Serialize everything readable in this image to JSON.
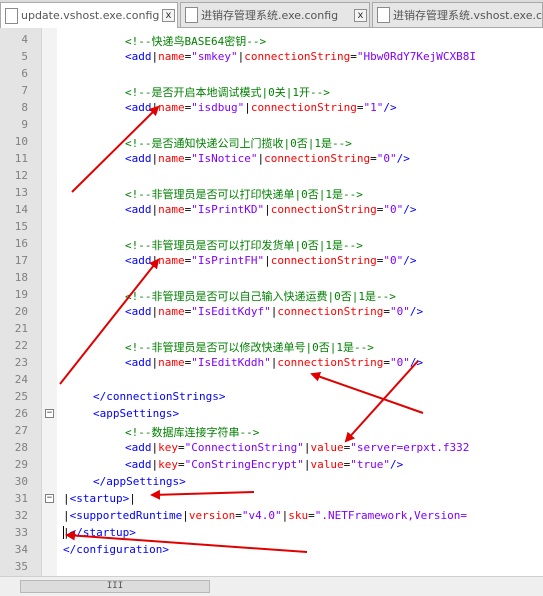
{
  "tabs": [
    {
      "label": "update.vshost.exe.config",
      "active": true
    },
    {
      "label": "进销存管理系统.exe.config",
      "active": false
    },
    {
      "label": "进销存管理系统.vshost.exe.config",
      "active": false
    }
  ],
  "close_glyph": "x",
  "scroll_grip": "III",
  "lines": [
    {
      "n": "4",
      "tokens": [
        {
          "t": "<!--快递鸟BASE64密钥-->",
          "c": "comment"
        }
      ]
    },
    {
      "n": "5",
      "tokens": [
        {
          "t": "<add",
          "c": "tag"
        },
        {
          "t": "|",
          "c": "sep"
        },
        {
          "t": "name",
          "c": "attr"
        },
        {
          "t": "=",
          "c": "sep"
        },
        {
          "t": "\"smkey\"",
          "c": "val"
        },
        {
          "t": "|",
          "c": "sep"
        },
        {
          "t": "connectionString",
          "c": "attr"
        },
        {
          "t": "=",
          "c": "sep"
        },
        {
          "t": "\"Hbw0RdY7KejWCXB8I",
          "c": "val"
        }
      ]
    },
    {
      "n": "6",
      "tokens": []
    },
    {
      "n": "7",
      "tokens": [
        {
          "t": "<!--是否开启本地调试模式|0关|1开-->",
          "c": "comment"
        }
      ]
    },
    {
      "n": "8",
      "tokens": [
        {
          "t": "<add",
          "c": "tag"
        },
        {
          "t": "|",
          "c": "sep"
        },
        {
          "t": "name",
          "c": "attr"
        },
        {
          "t": "=",
          "c": "sep"
        },
        {
          "t": "\"isdbug\"",
          "c": "val"
        },
        {
          "t": "|",
          "c": "sep"
        },
        {
          "t": "connectionString",
          "c": "attr"
        },
        {
          "t": "=",
          "c": "sep"
        },
        {
          "t": "\"1\"",
          "c": "val"
        },
        {
          "t": "/>",
          "c": "tag"
        }
      ]
    },
    {
      "n": "9",
      "tokens": []
    },
    {
      "n": "10",
      "tokens": [
        {
          "t": "<!--是否通知快递公司上门揽收|0否|1是-->",
          "c": "comment"
        }
      ]
    },
    {
      "n": "11",
      "tokens": [
        {
          "t": "<add",
          "c": "tag"
        },
        {
          "t": "|",
          "c": "sep"
        },
        {
          "t": "name",
          "c": "attr"
        },
        {
          "t": "=",
          "c": "sep"
        },
        {
          "t": "\"IsNotice\"",
          "c": "val"
        },
        {
          "t": "|",
          "c": "sep"
        },
        {
          "t": "connectionString",
          "c": "attr"
        },
        {
          "t": "=",
          "c": "sep"
        },
        {
          "t": "\"0\"",
          "c": "val"
        },
        {
          "t": "/>",
          "c": "tag"
        }
      ]
    },
    {
      "n": "12",
      "tokens": []
    },
    {
      "n": "13",
      "tokens": [
        {
          "t": "<!--非管理员是否可以打印快递单|0否|1是-->",
          "c": "comment"
        }
      ]
    },
    {
      "n": "14",
      "tokens": [
        {
          "t": "<add",
          "c": "tag"
        },
        {
          "t": "|",
          "c": "sep"
        },
        {
          "t": "name",
          "c": "attr"
        },
        {
          "t": "=",
          "c": "sep"
        },
        {
          "t": "\"IsPrintKD\"",
          "c": "val"
        },
        {
          "t": "|",
          "c": "sep"
        },
        {
          "t": "connectionString",
          "c": "attr"
        },
        {
          "t": "=",
          "c": "sep"
        },
        {
          "t": "\"0\"",
          "c": "val"
        },
        {
          "t": "/>",
          "c": "tag"
        }
      ]
    },
    {
      "n": "15",
      "tokens": []
    },
    {
      "n": "16",
      "tokens": [
        {
          "t": "<!--非管理员是否可以打印发货单|0否|1是-->",
          "c": "comment"
        }
      ]
    },
    {
      "n": "17",
      "tokens": [
        {
          "t": "<add",
          "c": "tag"
        },
        {
          "t": "|",
          "c": "sep"
        },
        {
          "t": "name",
          "c": "attr"
        },
        {
          "t": "=",
          "c": "sep"
        },
        {
          "t": "\"IsPrintFH\"",
          "c": "val"
        },
        {
          "t": "|",
          "c": "sep"
        },
        {
          "t": "connectionString",
          "c": "attr"
        },
        {
          "t": "=",
          "c": "sep"
        },
        {
          "t": "\"0\"",
          "c": "val"
        },
        {
          "t": "/>",
          "c": "tag"
        }
      ]
    },
    {
      "n": "18",
      "tokens": []
    },
    {
      "n": "19",
      "tokens": [
        {
          "t": "<!--非管理员是否可以自己输入快递运费|0否|1是-->",
          "c": "comment"
        }
      ]
    },
    {
      "n": "20",
      "tokens": [
        {
          "t": "<add",
          "c": "tag"
        },
        {
          "t": "|",
          "c": "sep"
        },
        {
          "t": "name",
          "c": "attr"
        },
        {
          "t": "=",
          "c": "sep"
        },
        {
          "t": "\"IsEditKdyf\"",
          "c": "val"
        },
        {
          "t": "|",
          "c": "sep"
        },
        {
          "t": "connectionString",
          "c": "attr"
        },
        {
          "t": "=",
          "c": "sep"
        },
        {
          "t": "\"0\"",
          "c": "val"
        },
        {
          "t": "/>",
          "c": "tag"
        }
      ]
    },
    {
      "n": "21",
      "tokens": []
    },
    {
      "n": "22",
      "tokens": [
        {
          "t": "<!--非管理员是否可以修改快递单号|0否|1是-->",
          "c": "comment"
        }
      ]
    },
    {
      "n": "23",
      "tokens": [
        {
          "t": "<add",
          "c": "tag"
        },
        {
          "t": "|",
          "c": "sep"
        },
        {
          "t": "name",
          "c": "attr"
        },
        {
          "t": "=",
          "c": "sep"
        },
        {
          "t": "\"IsEditKddh\"",
          "c": "val"
        },
        {
          "t": "|",
          "c": "sep"
        },
        {
          "t": "connectionString",
          "c": "attr"
        },
        {
          "t": "=",
          "c": "sep"
        },
        {
          "t": "\"0\"",
          "c": "val"
        },
        {
          "t": "/>",
          "c": "tag"
        }
      ]
    },
    {
      "n": "24",
      "tokens": []
    },
    {
      "n": "25",
      "tokens": [
        {
          "t": "</connectionStrings>",
          "c": "tag"
        }
      ]
    },
    {
      "n": "26",
      "fold": "−",
      "tokens": [
        {
          "t": "<appSettings>",
          "c": "tag"
        }
      ]
    },
    {
      "n": "27",
      "tokens": [
        {
          "t": "<!--数据库连接字符串-->",
          "c": "comment"
        }
      ]
    },
    {
      "n": "28",
      "tokens": [
        {
          "t": "<add",
          "c": "tag"
        },
        {
          "t": "|",
          "c": "sep"
        },
        {
          "t": "key",
          "c": "attr"
        },
        {
          "t": "=",
          "c": "sep"
        },
        {
          "t": "\"ConnectionString\"",
          "c": "val"
        },
        {
          "t": "|",
          "c": "sep"
        },
        {
          "t": "value",
          "c": "attr"
        },
        {
          "t": "=",
          "c": "sep"
        },
        {
          "t": "\"server=erpxt.f332",
          "c": "val"
        }
      ]
    },
    {
      "n": "29",
      "tokens": [
        {
          "t": "<add",
          "c": "tag"
        },
        {
          "t": "|",
          "c": "sep"
        },
        {
          "t": "key",
          "c": "attr"
        },
        {
          "t": "=",
          "c": "sep"
        },
        {
          "t": "\"ConStringEncrypt\"",
          "c": "val"
        },
        {
          "t": "|",
          "c": "sep"
        },
        {
          "t": "value",
          "c": "attr"
        },
        {
          "t": "=",
          "c": "sep"
        },
        {
          "t": "\"true\"",
          "c": "val"
        },
        {
          "t": "/>",
          "c": "tag"
        }
      ]
    },
    {
      "n": "30",
      "tokens": [
        {
          "t": "</appSettings>",
          "c": "tag"
        }
      ]
    },
    {
      "n": "31",
      "fold": "−",
      "tokens": [
        {
          "t": "|",
          "c": "sep"
        },
        {
          "t": "<startup>",
          "c": "tag"
        },
        {
          "t": "|",
          "c": "sep"
        }
      ]
    },
    {
      "n": "32",
      "tokens": [
        {
          "t": "|",
          "c": "sep"
        },
        {
          "t": "<supportedRuntime",
          "c": "tag"
        },
        {
          "t": "|",
          "c": "sep"
        },
        {
          "t": "version",
          "c": "attr"
        },
        {
          "t": "=",
          "c": "sep"
        },
        {
          "t": "\"v4.0\"",
          "c": "val"
        },
        {
          "t": "|",
          "c": "sep"
        },
        {
          "t": "sku",
          "c": "attr"
        },
        {
          "t": "=",
          "c": "sep"
        },
        {
          "t": "\".NETFramework,Version=",
          "c": "val"
        }
      ]
    },
    {
      "n": "33",
      "tokens": [
        {
          "t": "|",
          "c": "sep"
        },
        {
          "t": "</startup>",
          "c": "tag"
        }
      ]
    },
    {
      "n": "34",
      "tokens": [
        {
          "t": "</configuration>",
          "c": "tag"
        }
      ]
    },
    {
      "n": "35",
      "tokens": []
    }
  ]
}
